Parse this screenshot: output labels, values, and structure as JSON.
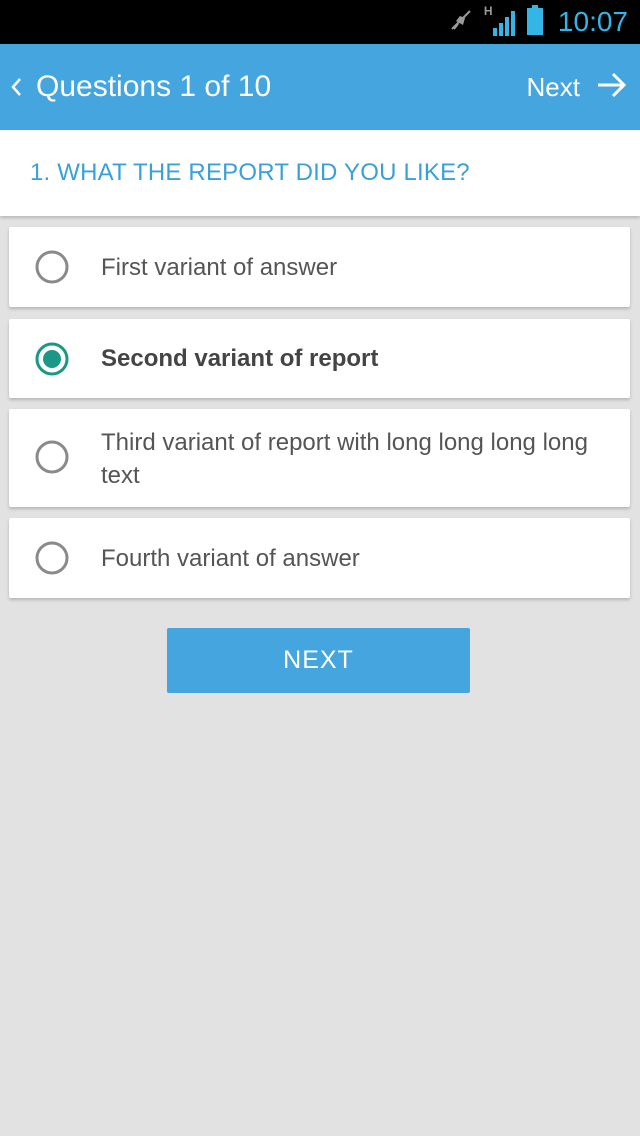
{
  "status_bar": {
    "time": "10:07",
    "network_label": "H",
    "icons": [
      "mute-icon",
      "signal-icon",
      "battery-icon"
    ]
  },
  "app_bar": {
    "title": "Questions 1 of 10",
    "next_label": "Next",
    "icons": [
      "chevron-left-icon",
      "arrow-right-icon"
    ],
    "background": "#45a5de"
  },
  "question": {
    "text": "1. WHAT THE REPORT DID YOU LIKE?",
    "color": "#3aa0da"
  },
  "answers": [
    {
      "label": "First variant of answer",
      "selected": false
    },
    {
      "label": "Second variant of report",
      "selected": true
    },
    {
      "label": "Third variant of report with long long long long text",
      "selected": false
    },
    {
      "label": "Fourth variant of answer",
      "selected": false
    }
  ],
  "next_button": {
    "label": "NEXT"
  },
  "colors": {
    "accent": "#45a5de",
    "radio_selected": "#1b9787",
    "radio_unselected": "#8a8a8a",
    "background": "#e2e2e2"
  }
}
